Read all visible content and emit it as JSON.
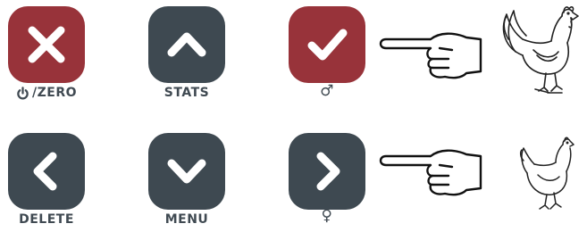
{
  "colors": {
    "red": "#98333a",
    "dark": "#3e4951",
    "label": "#404a52"
  },
  "buttons": [
    {
      "name": "zero-button",
      "icon": "x-icon",
      "label": "/ZERO",
      "label_icon": "power-icon"
    },
    {
      "name": "stats-button",
      "icon": "chevron-up-icon",
      "label": "STATS"
    },
    {
      "name": "male-button",
      "icon": "checkmark-icon",
      "label": "♂"
    },
    {
      "name": "delete-button",
      "icon": "chevron-left-icon",
      "label": "DELETE"
    },
    {
      "name": "menu-button",
      "icon": "chevron-down-icon",
      "label": "MENU"
    },
    {
      "name": "female-button",
      "icon": "chevron-right-icon",
      "label": "♀"
    }
  ],
  "illustrations": [
    {
      "name": "pointing-hand-icon"
    },
    {
      "name": "rooster-icon"
    },
    {
      "name": "hen-icon"
    }
  ]
}
